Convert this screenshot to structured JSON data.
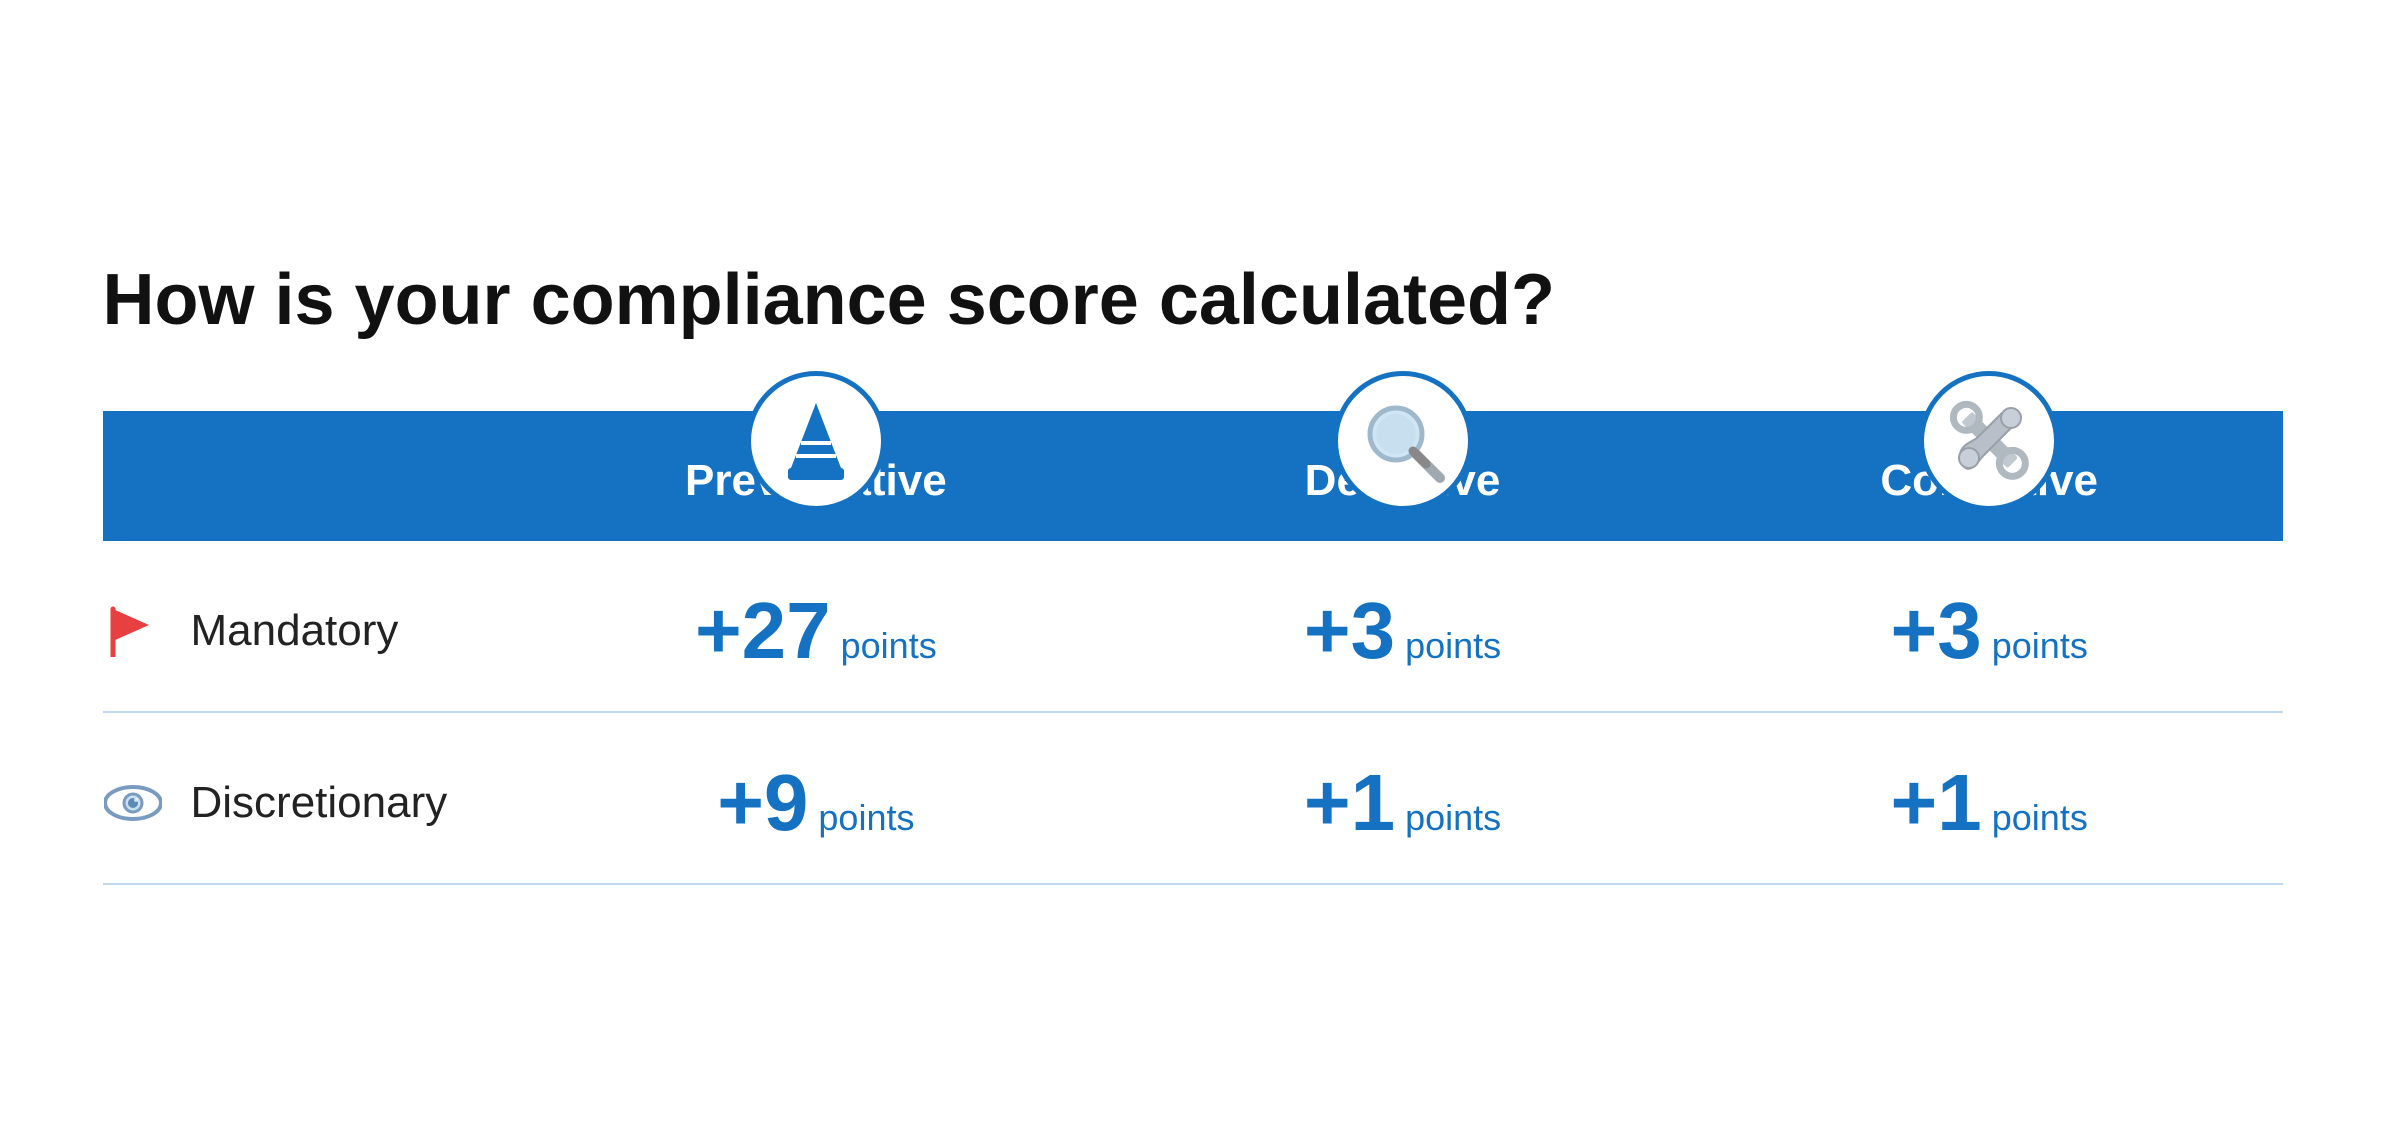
{
  "title": "How is your compliance score calculated?",
  "columns": [
    {
      "id": "preventative",
      "label": "Preventative",
      "icon": "cone"
    },
    {
      "id": "detective",
      "label": "Detective",
      "icon": "magnifier"
    },
    {
      "id": "corrective",
      "label": "Corrective",
      "icon": "wrench"
    }
  ],
  "rows": [
    {
      "id": "mandatory",
      "label": "Mandatory",
      "icon": "flag",
      "values": [
        "+27",
        "+3",
        "+3"
      ],
      "unit": "points"
    },
    {
      "id": "discretionary",
      "label": "Discretionary",
      "icon": "eye",
      "values": [
        "+9",
        "+1",
        "+1"
      ],
      "unit": "points"
    }
  ],
  "colors": {
    "blue": "#1572c2",
    "text": "#111111"
  }
}
